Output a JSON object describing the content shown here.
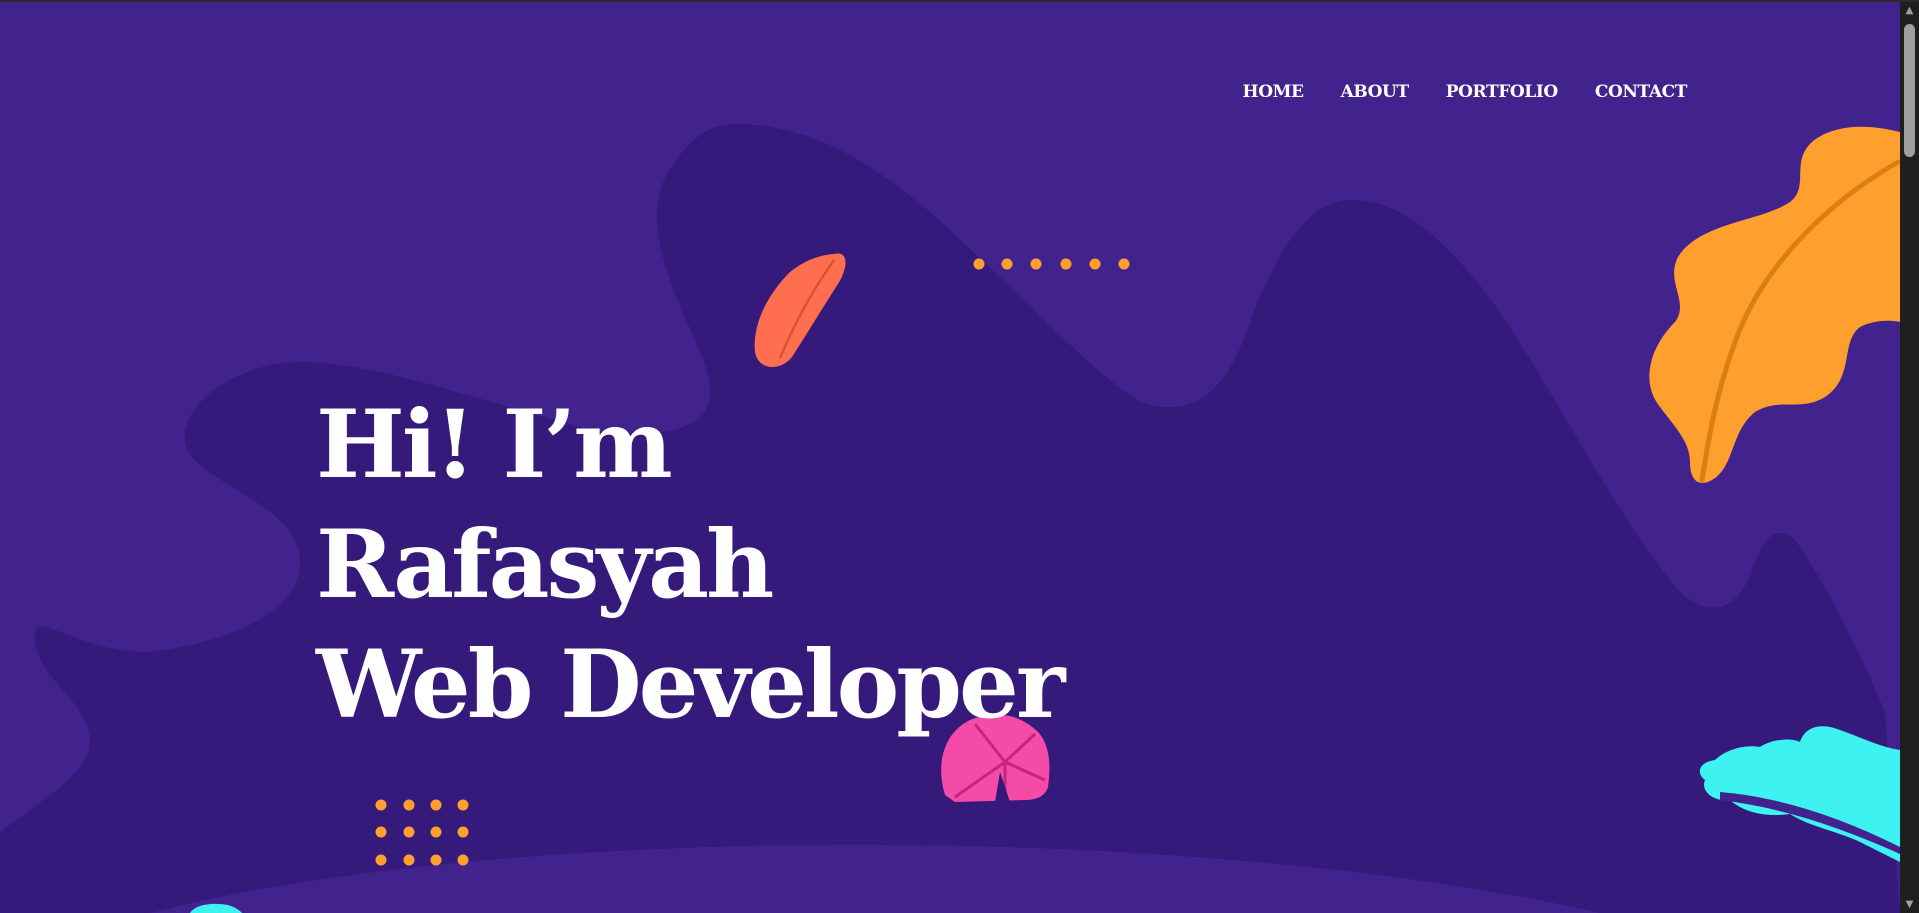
{
  "nav": {
    "items": [
      {
        "label": "HOME"
      },
      {
        "label": "ABOUT"
      },
      {
        "label": "PORTFOLIO"
      },
      {
        "label": "CONTACT"
      }
    ]
  },
  "hero": {
    "line1": "Hi! I’m",
    "line2": "Rafasyah",
    "line3": "Web Developer"
  },
  "colors": {
    "background": "#42238e",
    "blob": "#351a7c",
    "orange_leaf": "#ff9f2e",
    "coral_leaf": "#ff6f4f",
    "pink_shell": "#f44ba8",
    "cyan_leaf": "#3ef2f2",
    "dots": "#ff9f2e",
    "text": "#ffffff"
  },
  "icons": {
    "scroll_up": "scroll-up-arrow-icon",
    "scroll_down": "scroll-down-arrow-icon"
  }
}
